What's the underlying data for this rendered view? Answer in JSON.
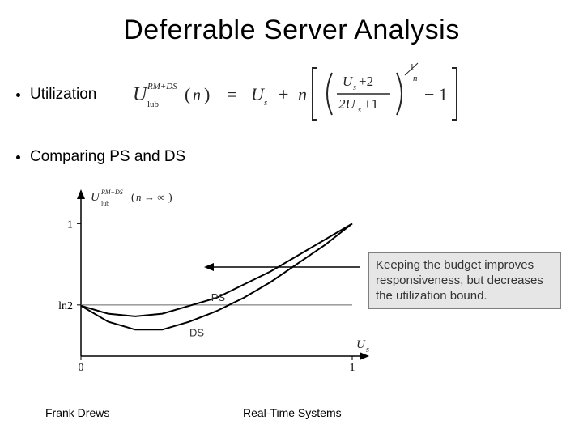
{
  "title": "Deferrable Server Analysis",
  "bullets": {
    "b1": "Utilization",
    "b2": "Comparing PS and DS"
  },
  "formula": {
    "lhs_main": "U",
    "lhs_sub": "lub",
    "lhs_sup": "RM+DS",
    "arg": "n",
    "rhs_prefix": "U",
    "rhs_sub": "s",
    "plus": "+",
    "n": "n",
    "frac_top_a": "U",
    "frac_top_sub": "s",
    "frac_top_tail": "+2",
    "frac_bot_a": "2U",
    "frac_bot_sub": "s",
    "frac_bot_tail": "+1",
    "exp_frac_top": "1",
    "exp_frac_bot": "n",
    "minus1": "− 1"
  },
  "callout": "Keeping the budget improves responsiveness, but decreases the utilization bound.",
  "footer": {
    "left": "Frank Drews",
    "center": "Real-Time Systems"
  },
  "chart_data": {
    "type": "line",
    "title": "",
    "xlabel": "Uₛ",
    "ylabel": "U_lub^{RM+DS}(n → ∞)",
    "xlim": [
      0,
      1
    ],
    "ylim": [
      0.5,
      1.05
    ],
    "yticks": [
      {
        "v": 0.693,
        "label": "ln2"
      },
      {
        "v": 1.0,
        "label": "1"
      }
    ],
    "xticks": [
      {
        "v": 0,
        "label": "0"
      },
      {
        "v": 1,
        "label": "1"
      }
    ],
    "series": [
      {
        "name": "PS",
        "x": [
          0.0,
          0.1,
          0.2,
          0.3,
          0.4,
          0.5,
          0.6,
          0.7,
          0.8,
          0.9,
          1.0
        ],
        "values": [
          0.69,
          0.66,
          0.65,
          0.66,
          0.69,
          0.72,
          0.77,
          0.82,
          0.88,
          0.94,
          1.0
        ]
      },
      {
        "name": "DS",
        "x": [
          0.0,
          0.1,
          0.2,
          0.3,
          0.4,
          0.5,
          0.6,
          0.7,
          0.8,
          0.9,
          1.0
        ],
        "values": [
          0.69,
          0.63,
          0.6,
          0.6,
          0.63,
          0.67,
          0.72,
          0.78,
          0.85,
          0.92,
          1.0
        ]
      }
    ]
  }
}
